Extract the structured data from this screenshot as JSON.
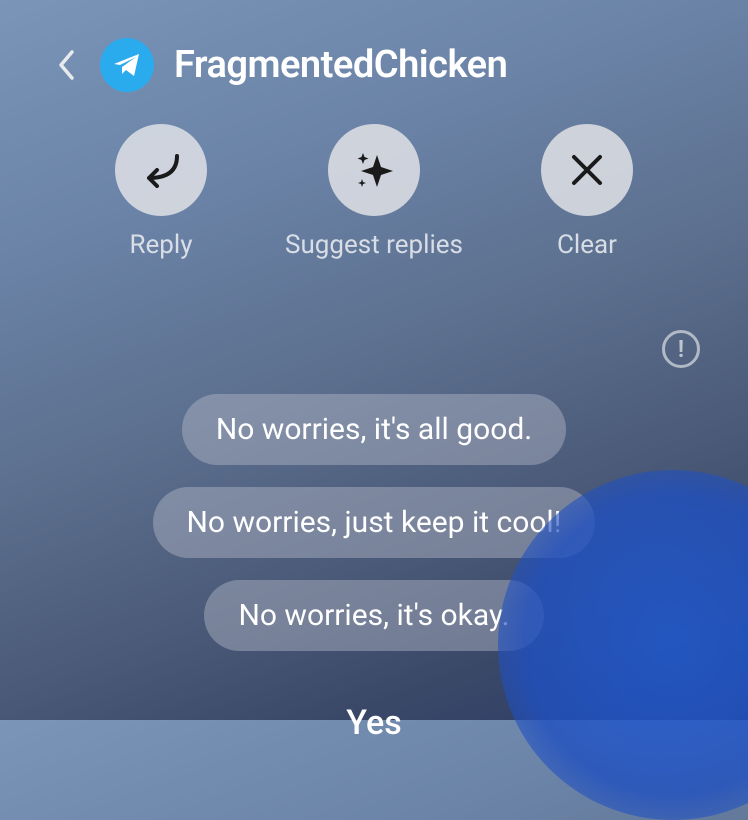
{
  "header": {
    "contact_name": "FragmentedChicken"
  },
  "actions": {
    "reply_label": "Reply",
    "suggest_label": "Suggest replies",
    "clear_label": "Clear"
  },
  "suggestions": [
    "No worries, it's all good.",
    "No worries, just keep it cool!",
    "No worries, it's okay."
  ],
  "bottom_reply": "Yes"
}
